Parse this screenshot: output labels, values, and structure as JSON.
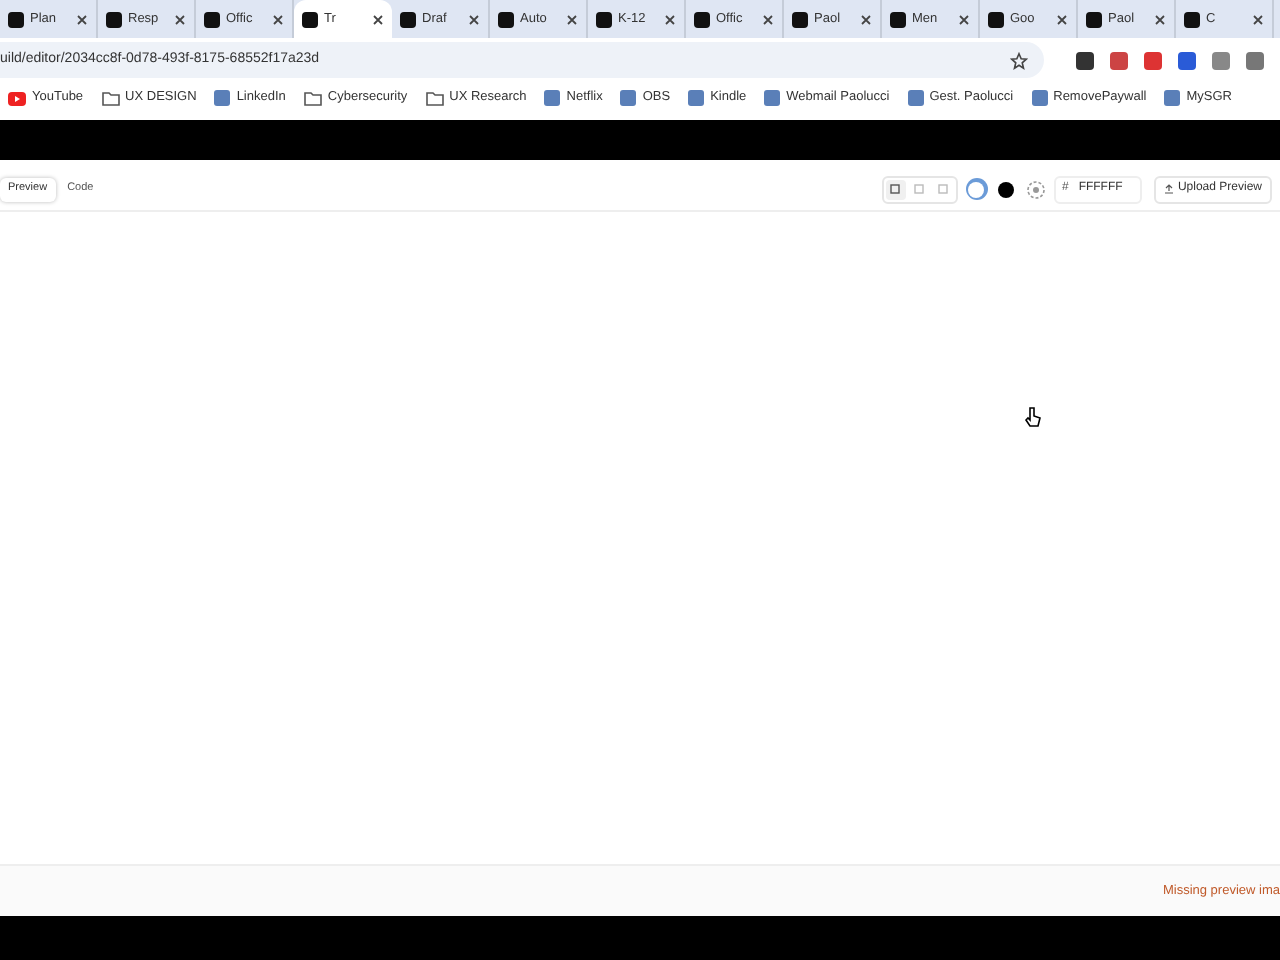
{
  "browser": {
    "tabs": [
      {
        "title": "Plan",
        "selected": false
      },
      {
        "title": "Resp",
        "selected": false
      },
      {
        "title": "Offic",
        "selected": false
      },
      {
        "title": "Tr",
        "selected": true
      },
      {
        "title": "Draf",
        "selected": false
      },
      {
        "title": "Auto",
        "selected": false
      },
      {
        "title": "K-12",
        "selected": false
      },
      {
        "title": "Offic",
        "selected": false
      },
      {
        "title": "Paol",
        "selected": false
      },
      {
        "title": "Men",
        "selected": false
      },
      {
        "title": "Goo",
        "selected": false
      },
      {
        "title": "Paol",
        "selected": false
      },
      {
        "title": "C",
        "selected": false
      }
    ],
    "address": "uild/editor/2034cc8f-0d78-493f-8175-68552f17a23d",
    "bookmarks": [
      {
        "label": "YouTube",
        "kind": "video"
      },
      {
        "label": "UX DESIGN",
        "kind": "folder"
      },
      {
        "label": "LinkedIn",
        "kind": "site"
      },
      {
        "label": "Cybersecurity",
        "kind": "folder"
      },
      {
        "label": "UX Research",
        "kind": "folder"
      },
      {
        "label": "Netflix",
        "kind": "site"
      },
      {
        "label": "OBS",
        "kind": "site"
      },
      {
        "label": "Kindle",
        "kind": "site"
      },
      {
        "label": "Webmail Paolucci",
        "kind": "site"
      },
      {
        "label": "Gest. Paolucci",
        "kind": "site"
      },
      {
        "label": "RemovePaywall",
        "kind": "site"
      },
      {
        "label": "MySGR",
        "kind": "site"
      }
    ]
  },
  "toolbar": {
    "modes": [
      {
        "label": "Preview",
        "selected": true
      },
      {
        "label": "Code",
        "selected": false
      }
    ],
    "devices": [
      {
        "selected": true
      },
      {
        "selected": false
      },
      {
        "selected": false
      }
    ],
    "backgrounds": [
      {
        "color": "#ffffff",
        "selected": true
      },
      {
        "color": "#000000",
        "selected": false
      }
    ],
    "hash": "#",
    "hex": "FFFFFF",
    "upload": "Upload Preview"
  },
  "footer": {
    "message": "Missing preview ima"
  }
}
